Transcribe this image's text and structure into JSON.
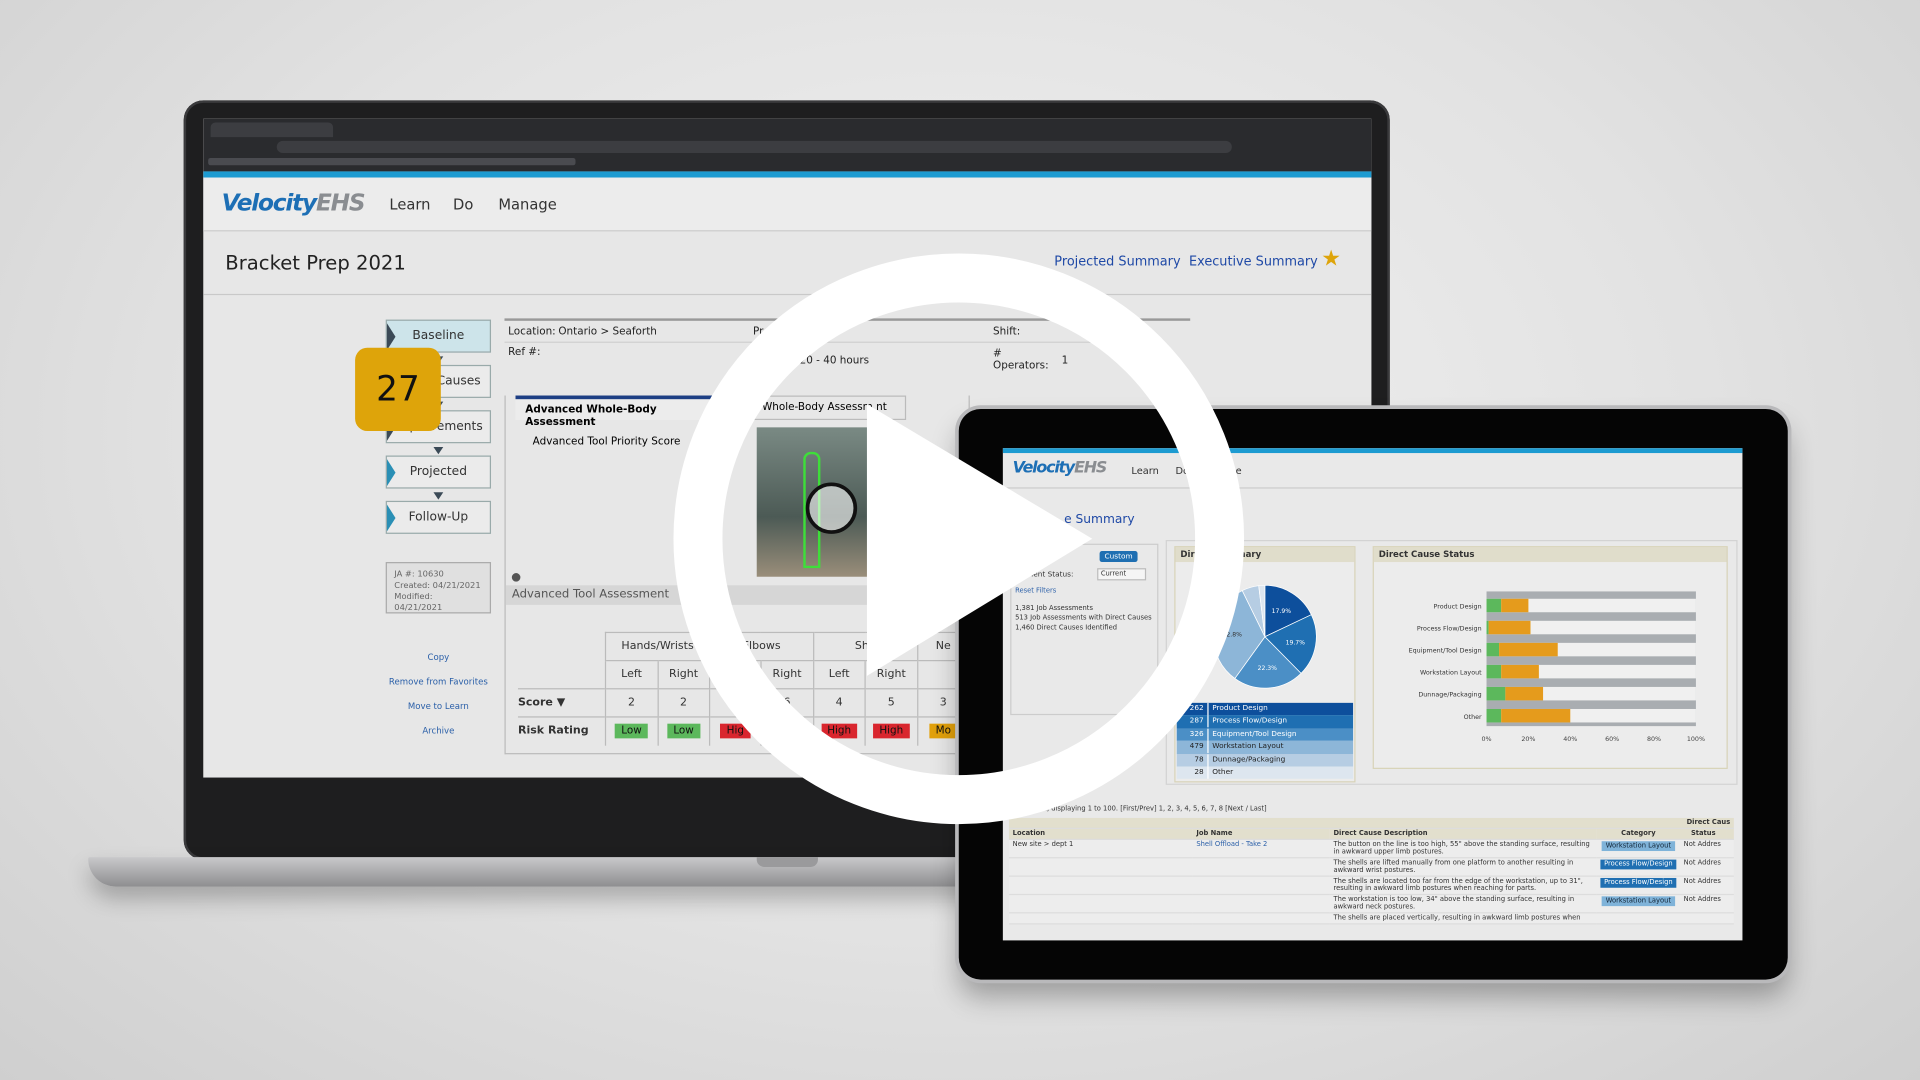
{
  "laptop_app": {
    "logo": {
      "brand": "Velocity",
      "suffix": "EHS"
    },
    "nav": [
      "Learn",
      "Do",
      "Manage"
    ],
    "page_title": "Bracket Prep 2021",
    "header_links": {
      "projected_summary": "Projected Summary",
      "executive_summary": "Executive Summary"
    },
    "favorite_icon": "star-icon",
    "steps": [
      "Baseline",
      "Direct Causes",
      "Improvements",
      "Projected",
      "Follow-Up"
    ],
    "active_step": "Baseline",
    "meta": {
      "ja": "JA #: 10630",
      "created": "Created: 04/21/2021",
      "modified": "Modified: 04/21/2021"
    },
    "side_links": [
      "Copy",
      "Remove from Favorites",
      "Move to Learn",
      "Archive"
    ],
    "info": {
      "location_label": "Location:",
      "location_value": "Ontario > Seaforth",
      "pr_label": "Pr",
      "shift_label": "Shift:",
      "ref_label": "Ref #:",
      "hours": "20 - 40 hours",
      "operators_label": "# Operators:",
      "operators_value": "1"
    },
    "tabs": [
      "Advanced Whole-Body Assessment",
      "anual Whole-Body Assessm  nt"
    ],
    "priority_label": "Advanced Tool Priority Score",
    "priority_score": "27",
    "section_title": "Advanced Tool Assessment",
    "table": {
      "groups": [
        "Hands/Wrists",
        "Elbows",
        "Sho",
        "Ne"
      ],
      "sides": [
        "Left",
        "Right",
        "ft",
        "Right",
        "Left",
        "Right",
        ""
      ],
      "score_label": "Score",
      "scores": [
        "2",
        "2",
        "",
        "6",
        "4",
        "5",
        "3"
      ],
      "risk_label": "Risk Rating",
      "risks": [
        {
          "t": "Low",
          "c": "low"
        },
        {
          "t": "Low",
          "c": "low"
        },
        {
          "t": "Hig",
          "c": "high"
        },
        {
          "t": "High",
          "c": "high"
        },
        {
          "t": "High",
          "c": "high"
        },
        {
          "t": "High",
          "c": "high"
        },
        {
          "t": "Mo",
          "c": "mod"
        }
      ]
    }
  },
  "tablet_app": {
    "logo": {
      "brand": "Velocity",
      "suffix": "EHS"
    },
    "nav": [
      "Learn",
      "Do",
      "ge"
    ],
    "page_title": "e Summary",
    "filters": {
      "custom_button": "Custom",
      "status_label": "essment Status:",
      "status_value": "Current",
      "reset": "Reset Filters"
    },
    "stats": [
      "1,381 Job Assessments",
      "513 Job Assessments with Direct Causes",
      "1,460 Direct Causes Identified"
    ],
    "pie_panel_title": "Direct Ca     mmary",
    "status_panel_title": "Direct Cause Status",
    "records_text": "rds found, displaying 1 to 100. [First/Prev] 1, 2, 3, 4, 5, 6, 7, 8 [Next / Last]",
    "table_headers": {
      "group": "Direct Caus",
      "location": "Location",
      "job": "Job Name",
      "desc": "Direct Cause Description",
      "category": "Category",
      "status": "Status"
    },
    "rows": [
      {
        "location": "New site > dept 1",
        "job": "Shell Offload - Take 2",
        "desc": "The button on the line is too high, 55\" above the standing surface, resulting in awkward upper limb postures.",
        "category": "Workstation Layout",
        "status": "Not Addres"
      },
      {
        "location": "",
        "job": "",
        "desc": "The shells are lifted manually from one platform to another resulting in awkward wrist postures.",
        "category": "Process Flow/Design",
        "status": "Not Addres"
      },
      {
        "location": "",
        "job": "",
        "desc": "The shells are located too far from the edge of the workstation, up to 31\", resulting in awkward limb postures when reaching for parts.",
        "category": "Process Flow/Design",
        "status": "Not Addres"
      },
      {
        "location": "",
        "job": "",
        "desc": "The workstation is too low, 34\" above the standing surface, resulting in awkward neck postures.",
        "category": "Workstation Layout",
        "status": "Not Addres"
      },
      {
        "location": "",
        "job": "",
        "desc": "The shells are placed vertically, resulting in awkward limb postures when",
        "category": "",
        "status": ""
      }
    ]
  },
  "chart_data": [
    {
      "type": "pie",
      "title": "Direct Cause Summary",
      "categories": [
        "Product Design",
        "Process Flow/Design",
        "Equipment/Tool Design",
        "Workstation Layout",
        "Dunnage/Packaging",
        "Other"
      ],
      "values": [
        262,
        287,
        326,
        479,
        78,
        28
      ],
      "labels": [
        "17.9%",
        "19.7%",
        "22.3%",
        "2.8%",
        "",
        ""
      ],
      "colors": [
        "#0d4f9c",
        "#1f6fb2",
        "#4b8fc6",
        "#8db6d8",
        "#b6cde3",
        "#dde6ef"
      ]
    },
    {
      "type": "bar",
      "stacked": true,
      "orientation": "horizontal",
      "title": "Direct Cause Status",
      "categories": [
        "Product Design",
        "Process Flow/Design",
        "Equipment/Tool Design",
        "Workstation Layout",
        "Dunnage/Packaging",
        "Other"
      ],
      "series": [
        {
          "values": [
            7,
            1,
            6,
            7,
            9,
            7
          ],
          "color": "#5cb85c"
        },
        {
          "values": [
            13,
            20,
            28,
            18,
            18,
            33
          ],
          "color": "#e59b1c"
        }
      ],
      "xticks": [
        "0%",
        "20%",
        "40%",
        "60%",
        "80%",
        "100%"
      ],
      "xlim": [
        0,
        100
      ]
    }
  ],
  "play_icon": "play-icon"
}
